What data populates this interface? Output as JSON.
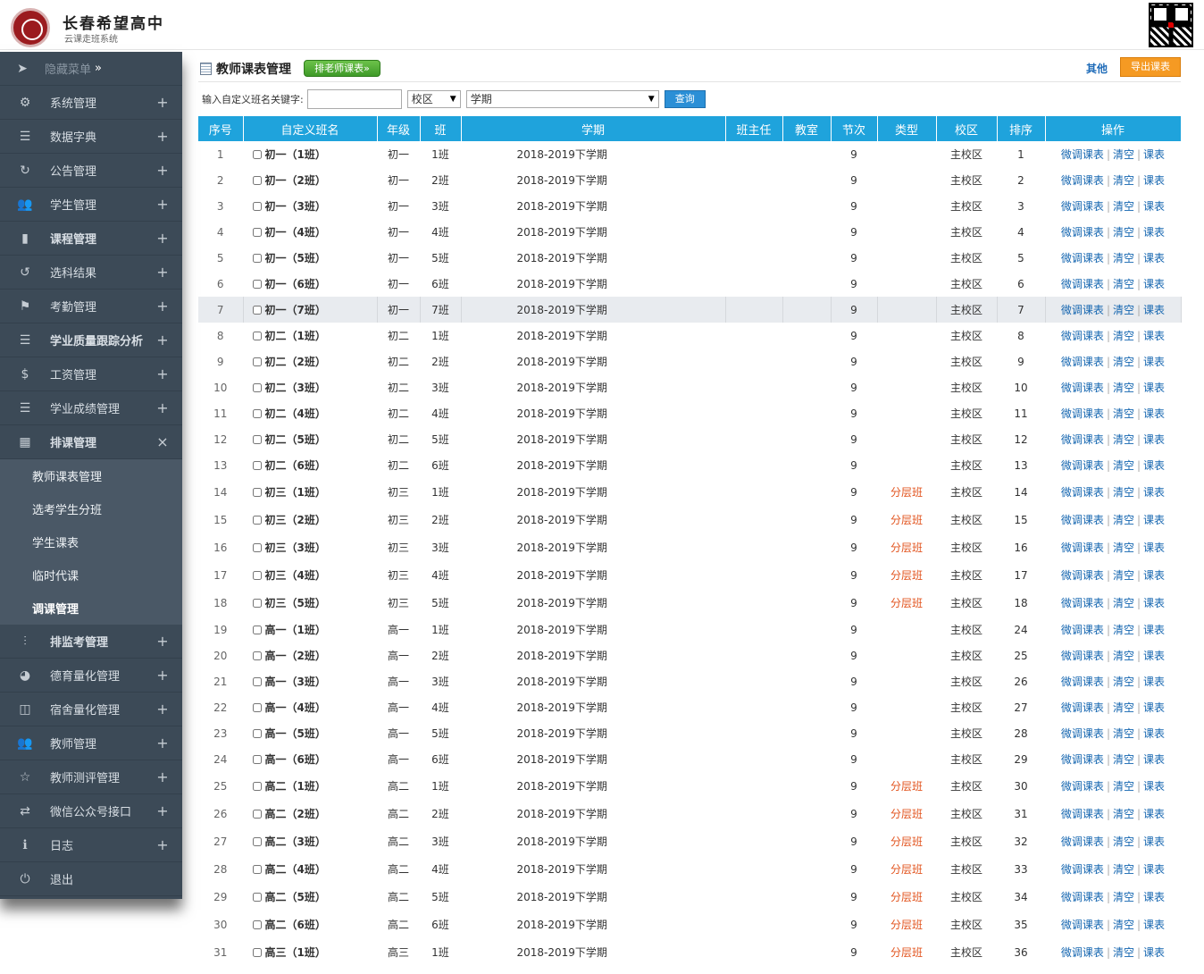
{
  "header": {
    "school_name": "长春希望高中",
    "system_name": "云课走班系统"
  },
  "sidebar": {
    "hide_menu": "隐藏菜单",
    "hide_menu_suffix": "»",
    "items": [
      {
        "label": "系统管理",
        "icon": "gear-icon",
        "symbol": "⚙",
        "toggle": "+"
      },
      {
        "label": "数据字典",
        "icon": "list-indent-icon",
        "symbol": "☰",
        "toggle": "+"
      },
      {
        "label": "公告管理",
        "icon": "refresh-icon",
        "symbol": "↻",
        "toggle": "+"
      },
      {
        "label": "学生管理",
        "icon": "users-icon",
        "symbol": "👥",
        "toggle": "+"
      },
      {
        "label": "课程管理",
        "icon": "bookmark-icon",
        "symbol": "▮",
        "toggle": "+",
        "bold": true
      },
      {
        "label": "选科结果",
        "icon": "history-icon",
        "symbol": "↺",
        "toggle": "+"
      },
      {
        "label": "考勤管理",
        "icon": "flag-icon",
        "symbol": "⚑",
        "toggle": "+"
      },
      {
        "label": "学业质量跟踪分析",
        "icon": "list-ordered-icon",
        "symbol": "☰",
        "toggle": "+",
        "bold": true
      },
      {
        "label": "工资管理",
        "icon": "dollar-icon",
        "symbol": "$",
        "toggle": "+"
      },
      {
        "label": "学业成绩管理",
        "icon": "list-icon",
        "symbol": "☰",
        "toggle": "+"
      }
    ],
    "open_item": {
      "label": "排课管理",
      "icon": "calendar-icon",
      "symbol": "▦",
      "toggle": "×"
    },
    "sub_items": [
      "教师课表管理",
      "选考学生分班",
      "学生课表",
      "临时代课",
      "调课管理"
    ],
    "active_sub": "调课管理",
    "items_after": [
      {
        "label": "排监考管理",
        "icon": "sliders-icon",
        "symbol": "⫶",
        "toggle": "+",
        "bold": true
      },
      {
        "label": "德育量化管理",
        "icon": "dashboard-icon",
        "symbol": "◕",
        "toggle": "+"
      },
      {
        "label": "宿舍量化管理",
        "icon": "columns-icon",
        "symbol": "◫",
        "toggle": "+"
      },
      {
        "label": "教师管理",
        "icon": "users-icon",
        "symbol": "👥",
        "toggle": "+"
      },
      {
        "label": "教师测评管理",
        "icon": "star-icon",
        "symbol": "☆",
        "toggle": "+"
      },
      {
        "label": "微信公众号接口",
        "icon": "exchange-icon",
        "symbol": "⇄",
        "toggle": "+"
      },
      {
        "label": "日志",
        "icon": "info-icon",
        "symbol": "ℹ",
        "toggle": "+"
      },
      {
        "label": "退出",
        "icon": "power-icon",
        "symbol": "⏻",
        "toggle": ""
      }
    ]
  },
  "main": {
    "title": "教师课表管理",
    "schedule_button": "排老师课表»",
    "other_link": "其他",
    "export_button": "导出课表",
    "filter": {
      "keyword_label": "输入自定义班名关键字:",
      "keyword_value": "",
      "campus_value": "校区",
      "term_value": "学期",
      "query_button": "查询"
    },
    "columns": [
      "序号",
      "自定义班名",
      "年级",
      "班",
      "学期",
      "班主任",
      "教室",
      "节次",
      "类型",
      "校区",
      "排序",
      "操作"
    ],
    "op_labels": [
      "微调课表",
      "清空",
      "课表"
    ],
    "rows": [
      {
        "no": "1",
        "name": "初一（1班）",
        "grade": "初一",
        "cls": "1班",
        "term": "2018-2019下学期",
        "teacher": "",
        "room": "",
        "periods": "9",
        "type": "",
        "campus": "主校区",
        "order": "1"
      },
      {
        "no": "2",
        "name": "初一（2班）",
        "grade": "初一",
        "cls": "2班",
        "term": "2018-2019下学期",
        "teacher": "",
        "room": "",
        "periods": "9",
        "type": "",
        "campus": "主校区",
        "order": "2"
      },
      {
        "no": "3",
        "name": "初一（3班）",
        "grade": "初一",
        "cls": "3班",
        "term": "2018-2019下学期",
        "teacher": "",
        "room": "",
        "periods": "9",
        "type": "",
        "campus": "主校区",
        "order": "3"
      },
      {
        "no": "4",
        "name": "初一（4班）",
        "grade": "初一",
        "cls": "4班",
        "term": "2018-2019下学期",
        "teacher": "",
        "room": "",
        "periods": "9",
        "type": "",
        "campus": "主校区",
        "order": "4"
      },
      {
        "no": "5",
        "name": "初一（5班）",
        "grade": "初一",
        "cls": "5班",
        "term": "2018-2019下学期",
        "teacher": "",
        "room": "",
        "periods": "9",
        "type": "",
        "campus": "主校区",
        "order": "5"
      },
      {
        "no": "6",
        "name": "初一（6班）",
        "grade": "初一",
        "cls": "6班",
        "term": "2018-2019下学期",
        "teacher": "",
        "room": "",
        "periods": "9",
        "type": "",
        "campus": "主校区",
        "order": "6"
      },
      {
        "no": "7",
        "name": "初一（7班）",
        "grade": "初一",
        "cls": "7班",
        "term": "2018-2019下学期",
        "teacher": "",
        "room": "",
        "periods": "9",
        "type": "",
        "campus": "主校区",
        "order": "7",
        "highlight": true
      },
      {
        "no": "8",
        "name": "初二（1班）",
        "grade": "初二",
        "cls": "1班",
        "term": "2018-2019下学期",
        "teacher": "",
        "room": "",
        "periods": "9",
        "type": "",
        "campus": "主校区",
        "order": "8"
      },
      {
        "no": "9",
        "name": "初二（2班）",
        "grade": "初二",
        "cls": "2班",
        "term": "2018-2019下学期",
        "teacher": "",
        "room": "",
        "periods": "9",
        "type": "",
        "campus": "主校区",
        "order": "9"
      },
      {
        "no": "10",
        "name": "初二（3班）",
        "grade": "初二",
        "cls": "3班",
        "term": "2018-2019下学期",
        "teacher": "",
        "room": "",
        "periods": "9",
        "type": "",
        "campus": "主校区",
        "order": "10"
      },
      {
        "no": "11",
        "name": "初二（4班）",
        "grade": "初二",
        "cls": "4班",
        "term": "2018-2019下学期",
        "teacher": "",
        "room": "",
        "periods": "9",
        "type": "",
        "campus": "主校区",
        "order": "11"
      },
      {
        "no": "12",
        "name": "初二（5班）",
        "grade": "初二",
        "cls": "5班",
        "term": "2018-2019下学期",
        "teacher": "",
        "room": "",
        "periods": "9",
        "type": "",
        "campus": "主校区",
        "order": "12"
      },
      {
        "no": "13",
        "name": "初二（6班）",
        "grade": "初二",
        "cls": "6班",
        "term": "2018-2019下学期",
        "teacher": "",
        "room": "",
        "periods": "9",
        "type": "",
        "campus": "主校区",
        "order": "13"
      },
      {
        "no": "14",
        "name": "初三（1班）",
        "grade": "初三",
        "cls": "1班",
        "term": "2018-2019下学期",
        "teacher": "",
        "room": "",
        "periods": "9",
        "type": "分层班",
        "campus": "主校区",
        "order": "14"
      },
      {
        "no": "15",
        "name": "初三（2班）",
        "grade": "初三",
        "cls": "2班",
        "term": "2018-2019下学期",
        "teacher": "",
        "room": "",
        "periods": "9",
        "type": "分层班",
        "campus": "主校区",
        "order": "15"
      },
      {
        "no": "16",
        "name": "初三（3班）",
        "grade": "初三",
        "cls": "3班",
        "term": "2018-2019下学期",
        "teacher": "",
        "room": "",
        "periods": "9",
        "type": "分层班",
        "campus": "主校区",
        "order": "16"
      },
      {
        "no": "17",
        "name": "初三（4班）",
        "grade": "初三",
        "cls": "4班",
        "term": "2018-2019下学期",
        "teacher": "",
        "room": "",
        "periods": "9",
        "type": "分层班",
        "campus": "主校区",
        "order": "17"
      },
      {
        "no": "18",
        "name": "初三（5班）",
        "grade": "初三",
        "cls": "5班",
        "term": "2018-2019下学期",
        "teacher": "",
        "room": "",
        "periods": "9",
        "type": "分层班",
        "campus": "主校区",
        "order": "18"
      },
      {
        "no": "19",
        "name": "高一（1班）",
        "grade": "高一",
        "cls": "1班",
        "term": "2018-2019下学期",
        "teacher": "",
        "room": "",
        "periods": "9",
        "type": "",
        "campus": "主校区",
        "order": "24"
      },
      {
        "no": "20",
        "name": "高一（2班）",
        "grade": "高一",
        "cls": "2班",
        "term": "2018-2019下学期",
        "teacher": "",
        "room": "",
        "periods": "9",
        "type": "",
        "campus": "主校区",
        "order": "25"
      },
      {
        "no": "21",
        "name": "高一（3班）",
        "grade": "高一",
        "cls": "3班",
        "term": "2018-2019下学期",
        "teacher": "",
        "room": "",
        "periods": "9",
        "type": "",
        "campus": "主校区",
        "order": "26"
      },
      {
        "no": "22",
        "name": "高一（4班）",
        "grade": "高一",
        "cls": "4班",
        "term": "2018-2019下学期",
        "teacher": "",
        "room": "",
        "periods": "9",
        "type": "",
        "campus": "主校区",
        "order": "27"
      },
      {
        "no": "23",
        "name": "高一（5班）",
        "grade": "高一",
        "cls": "5班",
        "term": "2018-2019下学期",
        "teacher": "",
        "room": "",
        "periods": "9",
        "type": "",
        "campus": "主校区",
        "order": "28"
      },
      {
        "no": "24",
        "name": "高一（6班）",
        "grade": "高一",
        "cls": "6班",
        "term": "2018-2019下学期",
        "teacher": "",
        "room": "",
        "periods": "9",
        "type": "",
        "campus": "主校区",
        "order": "29"
      },
      {
        "no": "25",
        "name": "高二（1班）",
        "grade": "高二",
        "cls": "1班",
        "term": "2018-2019下学期",
        "teacher": "",
        "room": "",
        "periods": "9",
        "type": "分层班",
        "campus": "主校区",
        "order": "30"
      },
      {
        "no": "26",
        "name": "高二（2班）",
        "grade": "高二",
        "cls": "2班",
        "term": "2018-2019下学期",
        "teacher": "",
        "room": "",
        "periods": "9",
        "type": "分层班",
        "campus": "主校区",
        "order": "31"
      },
      {
        "no": "27",
        "name": "高二（3班）",
        "grade": "高二",
        "cls": "3班",
        "term": "2018-2019下学期",
        "teacher": "",
        "room": "",
        "periods": "9",
        "type": "分层班",
        "campus": "主校区",
        "order": "32"
      },
      {
        "no": "28",
        "name": "高二（4班）",
        "grade": "高二",
        "cls": "4班",
        "term": "2018-2019下学期",
        "teacher": "",
        "room": "",
        "periods": "9",
        "type": "分层班",
        "campus": "主校区",
        "order": "33"
      },
      {
        "no": "29",
        "name": "高二（5班）",
        "grade": "高二",
        "cls": "5班",
        "term": "2018-2019下学期",
        "teacher": "",
        "room": "",
        "periods": "9",
        "type": "分层班",
        "campus": "主校区",
        "order": "34"
      },
      {
        "no": "30",
        "name": "高二（6班）",
        "grade": "高二",
        "cls": "6班",
        "term": "2018-2019下学期",
        "teacher": "",
        "room": "",
        "periods": "9",
        "type": "分层班",
        "campus": "主校区",
        "order": "35"
      },
      {
        "no": "31",
        "name": "高三（1班）",
        "grade": "高三",
        "cls": "1班",
        "term": "2018-2019下学期",
        "teacher": "",
        "room": "",
        "periods": "9",
        "type": "分层班",
        "campus": "主校区",
        "order": "36"
      }
    ]
  },
  "colors": {
    "sidebar_bg": "#3c4a57",
    "submenu_bg": "#4a5866",
    "table_header": "#1fa3dc",
    "link_blue": "#1566b0",
    "type_orange": "#e2531d",
    "export_orange": "#f59a23",
    "schedule_green": "#4caf36"
  }
}
